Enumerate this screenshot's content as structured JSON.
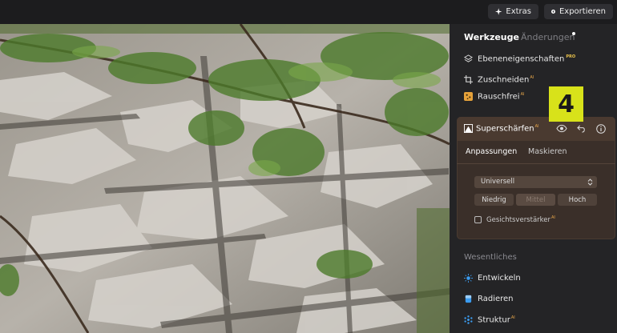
{
  "toolbar": {
    "extras_label": "Extras",
    "export_label": "Exportieren"
  },
  "panel": {
    "tabs": [
      {
        "label": "Werkzeuge",
        "active": true
      },
      {
        "label": "Änderungen",
        "active": false,
        "dot": true
      }
    ],
    "tools": [
      {
        "label": "Ebeneneigenschaften",
        "badge": "PRO",
        "icon": "layers-icon"
      },
      {
        "label": "Zuschneiden",
        "badge": "AI",
        "icon": "crop-icon"
      },
      {
        "label": "Rauschfrei",
        "badge": "AI",
        "icon": "denoise-icon"
      }
    ],
    "active_tool": {
      "title": "Superschärfen",
      "badge": "AI",
      "subtabs": [
        "Anpassungen",
        "Maskieren"
      ],
      "mode_select": "Universell",
      "levels": [
        "Niedrig",
        "Mittel",
        "Hoch"
      ],
      "selected_level": "Mittel",
      "face_enhancer_label": "Gesichtsverstärker",
      "face_enhancer_badge": "AI",
      "face_enhancer_checked": false
    },
    "section_title": "Wesentliches",
    "essentials": [
      {
        "label": "Entwickeln",
        "icon": "sun-icon",
        "color": "#3b9cf0"
      },
      {
        "label": "Radieren",
        "icon": "eraser-icon",
        "color": "#3b9cf0"
      },
      {
        "label": "Struktur",
        "badge": "AI",
        "icon": "structure-icon",
        "color": "#3b9cf0"
      }
    ]
  },
  "callout": {
    "number": "4",
    "color": "#d8e21a"
  }
}
